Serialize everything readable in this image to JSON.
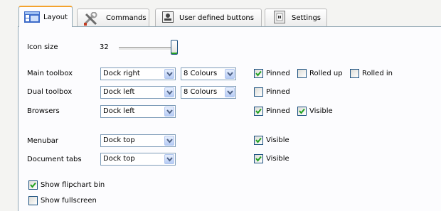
{
  "tabs": [
    {
      "label": "Layout",
      "icon": "layout-icon",
      "active": true
    },
    {
      "label": "Commands",
      "icon": "tools-icon",
      "active": false
    },
    {
      "label": "User defined buttons",
      "icon": "user-buttons-icon",
      "active": false
    },
    {
      "label": "Settings",
      "icon": "settings-icon",
      "active": false
    }
  ],
  "icon_size": {
    "label": "Icon size",
    "value": "32"
  },
  "rows": {
    "main_toolbox": {
      "label": "Main toolbox",
      "dock": "Dock right",
      "colours": "8 Colours",
      "checks": [
        {
          "label": "Pinned",
          "checked": true
        },
        {
          "label": "Rolled up",
          "checked": false
        },
        {
          "label": "Rolled in",
          "checked": false
        }
      ]
    },
    "dual_toolbox": {
      "label": "Dual toolbox",
      "dock": "Dock left",
      "colours": "8 Colours",
      "checks": [
        {
          "label": "Pinned",
          "checked": false
        }
      ]
    },
    "browsers": {
      "label": "Browsers",
      "dock": "Dock left",
      "checks": [
        {
          "label": "Pinned",
          "checked": true
        },
        {
          "label": "Visible",
          "checked": true
        }
      ]
    },
    "menubar": {
      "label": "Menubar",
      "dock": "Dock top",
      "checks": [
        {
          "label": "Visible",
          "checked": true
        }
      ]
    },
    "document_tabs": {
      "label": "Document tabs",
      "dock": "Dock top",
      "checks": [
        {
          "label": "Visible",
          "checked": true
        }
      ]
    }
  },
  "options": [
    {
      "label": "Show flipchart bin",
      "checked": true
    },
    {
      "label": "Show fullscreen",
      "checked": false
    }
  ],
  "colors": {
    "accent": "#f3a22d",
    "check": "#21a121",
    "border": "#7f9db9"
  }
}
